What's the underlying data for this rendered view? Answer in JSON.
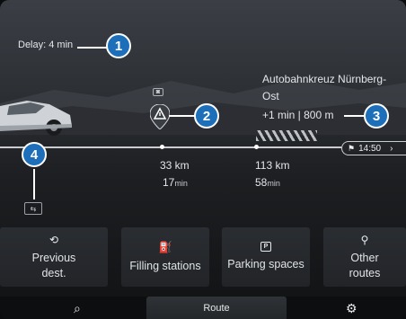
{
  "delay": {
    "text": "Delay: 4 min"
  },
  "destination": {
    "line1": "Autobahnkreuz Nürnberg-",
    "line2": "Ost",
    "detour": "+1 min | 800 m"
  },
  "eta": {
    "time": "14:50",
    "chevron": "›"
  },
  "segments": [
    {
      "distance": "33 km",
      "time_value": "17",
      "time_unit": "min"
    },
    {
      "distance": "113 km",
      "time_value": "58",
      "time_unit": "min"
    }
  ],
  "callouts": [
    "1",
    "2",
    "3",
    "4"
  ],
  "icons": {
    "warning": "warning-triangle-icon",
    "camera": "camera-icon",
    "traffic": "traffic-jam-icon",
    "history": "history-icon",
    "fuel": "fuel-pump-icon",
    "parking": "parking-icon",
    "routes": "route-icon",
    "search": "search-icon",
    "settings": "gear-icon",
    "flag": "checkered-flag-icon"
  },
  "tiles": [
    {
      "line1": "Previous",
      "line2": "dest."
    },
    {
      "line1": "Filling stations",
      "line2": ""
    },
    {
      "line1": "Parking spaces",
      "line2": ""
    },
    {
      "line1": "Other",
      "line2": "routes"
    }
  ],
  "bottom": {
    "route_label": "Route"
  },
  "colors": {
    "callout": "#1c6fb8",
    "background": "#2d3035",
    "text": "#e9ecef"
  }
}
